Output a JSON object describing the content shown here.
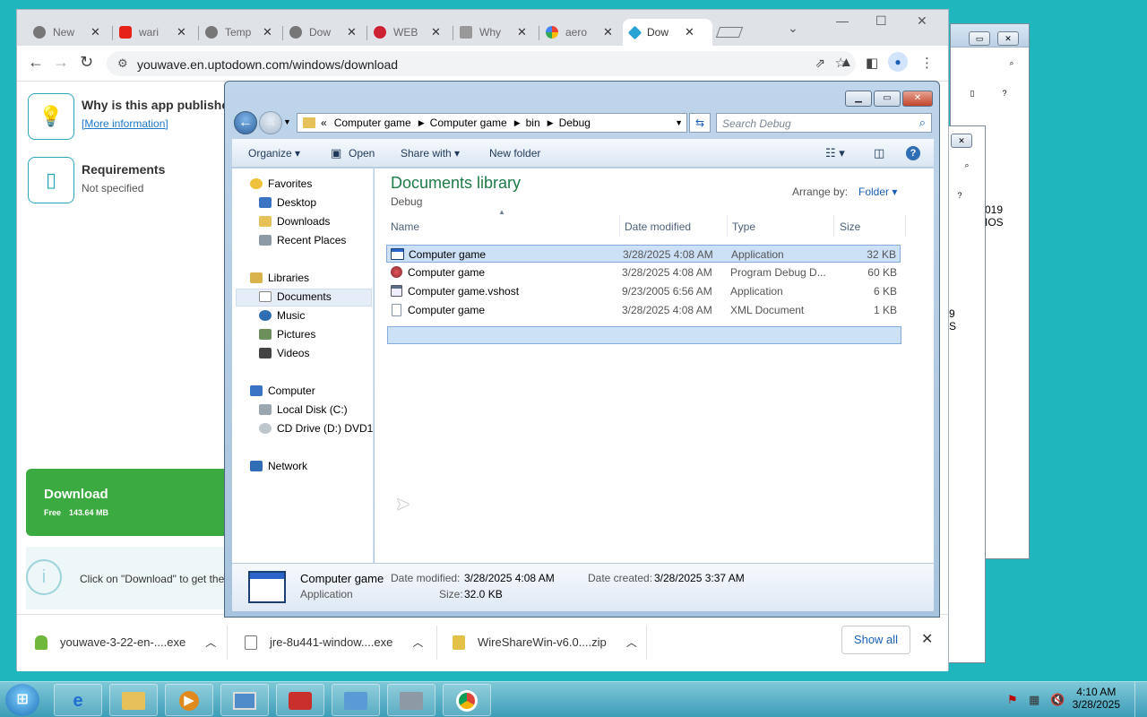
{
  "chrome": {
    "tabs": [
      {
        "label": "New"
      },
      {
        "label": "wari"
      },
      {
        "label": "Temp"
      },
      {
        "label": "Dow"
      },
      {
        "label": "WEB"
      },
      {
        "label": "Why"
      },
      {
        "label": "aero"
      },
      {
        "label": "Dow"
      }
    ],
    "url": "youwave.en.uptodown.com/windows/download"
  },
  "page": {
    "why_title": "Why is this app published",
    "more_info": "[More information]",
    "req_title": "Requirements",
    "req_value": "Not specified",
    "download_label": "Download",
    "download_free": "Free",
    "download_size": "143.64 MB",
    "info_text": "Click on \"Download\" to get the"
  },
  "downloads": {
    "items": [
      "youwave-3-22-en-....exe",
      "jre-8u441-window....exe",
      "WireShareWin-v6.0....zip"
    ],
    "show_all": "Show all"
  },
  "background_window": {
    "text1": "019",
    "text2": "IOS",
    "text3": "9",
    "text4": "S"
  },
  "explorer": {
    "address_prefix": "«",
    "breadcrumb": [
      "Computer game",
      "Computer game",
      "bin",
      "Debug"
    ],
    "search_placeholder": "Search Debug",
    "commands": {
      "organize": "Organize",
      "open": "Open",
      "share_with": "Share with",
      "new_folder": "New folder"
    },
    "nav": {
      "favorites": "Favorites",
      "desktop": "Desktop",
      "downloads": "Downloads",
      "recent_places": "Recent Places",
      "libraries": "Libraries",
      "documents": "Documents",
      "music": "Music",
      "pictures": "Pictures",
      "videos": "Videos",
      "computer": "Computer",
      "local_disk": "Local Disk (C:)",
      "cd_drive": "CD Drive (D:) DVD1",
      "network": "Network"
    },
    "library_title": "Documents library",
    "library_sub": "Debug",
    "arrange_by": "Arrange by:",
    "arrange_value": "Folder",
    "columns": {
      "name": "Name",
      "date": "Date modified",
      "type": "Type",
      "size": "Size"
    },
    "files": [
      {
        "name": "Computer game",
        "date": "3/28/2025 4:08 AM",
        "type": "Application",
        "size": "32 KB"
      },
      {
        "name": "Computer game",
        "date": "3/28/2025 4:08 AM",
        "type": "Program Debug D...",
        "size": "60 KB"
      },
      {
        "name": "Computer game.vshost",
        "date": "9/23/2005 6:56 AM",
        "type": "Application",
        "size": "6 KB"
      },
      {
        "name": "Computer game",
        "date": "3/28/2025 4:08 AM",
        "type": "XML Document",
        "size": "1 KB"
      }
    ],
    "details": {
      "name": "Computer game",
      "kind": "Application",
      "modified_label": "Date modified:",
      "modified_value": "3/28/2025 4:08 AM",
      "size_label": "Size:",
      "size_value": "32.0 KB",
      "created_label": "Date created:",
      "created_value": "3/28/2025 3:37 AM"
    }
  },
  "taskbar": {
    "time": "4:10 AM",
    "date": "3/28/2025"
  }
}
